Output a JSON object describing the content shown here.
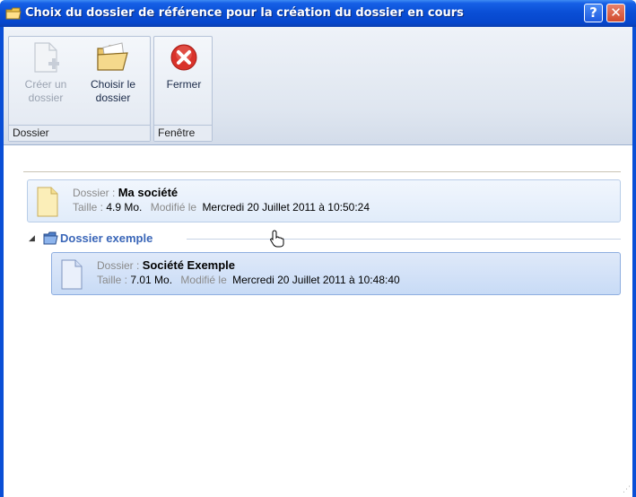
{
  "window": {
    "title": "Choix du dossier de référence pour la création du dossier en cours",
    "help_label": "?",
    "close_label": "✕"
  },
  "ribbon": {
    "groups": [
      {
        "label": "Dossier",
        "buttons": [
          {
            "label_line1": "Créer un",
            "label_line2": "dossier",
            "icon": "new-document-icon",
            "enabled": false
          },
          {
            "label_line1": "Choisir le",
            "label_line2": "dossier",
            "icon": "open-folder-icon",
            "enabled": true
          }
        ]
      },
      {
        "label": "Fenêtre",
        "buttons": [
          {
            "label_line1": "Fermer",
            "label_line2": "",
            "icon": "close-red-icon",
            "enabled": true
          }
        ]
      }
    ]
  },
  "items": [
    {
      "dossier_label": "Dossier : ",
      "name": "Ma société",
      "taille_label": "Taille : ",
      "taille": "4.9 Mo.",
      "modifie_label": "Modifié le",
      "modifie": "Mercredi 20 Juillet 2011 à 10:50:24",
      "icon": "yellow-document-icon"
    }
  ],
  "group": {
    "title": "Dossier exemple",
    "icon": "blue-folder-icon",
    "items": [
      {
        "dossier_label": "Dossier : ",
        "name": "Société Exemple",
        "taille_label": "Taille : ",
        "taille": "7.01 Mo.",
        "modifie_label": "Modifié le",
        "modifie": "Mercredi 20 Juillet 2011 à 10:48:40",
        "icon": "blue-document-icon"
      }
    ]
  },
  "colors": {
    "titlebar": "#0a4fd6",
    "group_title": "#3a66b8",
    "close_icon": "#d9322a"
  }
}
